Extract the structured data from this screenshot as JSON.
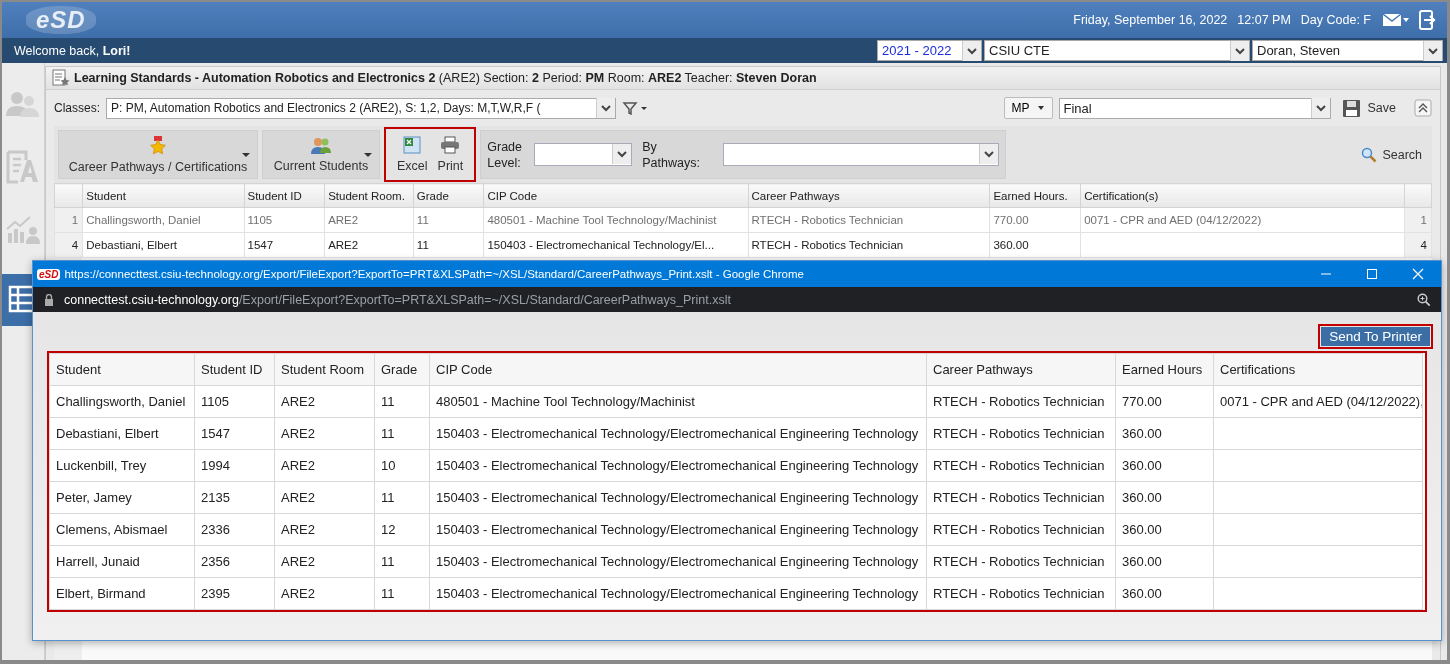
{
  "header": {
    "logo": "eSD",
    "date": "Friday, September 16, 2022",
    "time": "12:07 PM",
    "day_code": "Day Code: F"
  },
  "welcome": "Welcome back, **Lori!**",
  "selectors": [
    {
      "value": "2021 - 2022",
      "accent": true
    },
    {
      "value": "CSIU CTE",
      "accent": false
    },
    {
      "value": "Doran, Steven",
      "accent": false
    }
  ],
  "sidebar": {
    "items": [
      {
        "kind": "people",
        "selected": false
      },
      {
        "kind": "form",
        "selected": false
      },
      {
        "kind": "chart",
        "selected": false
      },
      {
        "kind": "table",
        "selected": true
      }
    ]
  },
  "panel": {
    "title": "**Learning Standards - Automation Robotics and Electronics 2** (ARE2) Section: **2** Period: **PM** Room: **ARE2** Teacher: **Steven Doran**",
    "classes_label": "Classes:",
    "classes_value": "P: PM, Automation Robotics and Electronics  2 (ARE2), S: 1,2, Days: M,T,W,R,F (",
    "mp": "MP",
    "term": "Final",
    "save": "Save"
  },
  "toolbar": {
    "career": "Career Pathways / Certifications",
    "students": "Current Students",
    "excel": "Excel",
    "print": "Print",
    "export_highlighted": true,
    "grade_label": "Grade Level:",
    "pathways_label": "By Pathways:",
    "search": "Search"
  },
  "grid": {
    "columns": [
      "Student",
      "Student ID",
      "Student Room.",
      "Grade",
      "CIP Code",
      "Career Pathways",
      "Earned Hours.",
      "Certification(s)"
    ],
    "rows": [
      {
        "num": "1",
        "dimmed": true,
        "cells": [
          "Challingsworth, Daniel",
          "1105",
          "ARE2",
          "11",
          "480501 - Machine Tool Technology/Machinist",
          "RTECH - Robotics Technician",
          "770.00",
          "0071 - CPR and AED (04/12/2022)"
        ],
        "end": "1"
      },
      {
        "num": "4",
        "dimmed": false,
        "cells": [
          "Debastiani, Elbert",
          "1547",
          "ARE2",
          "11",
          "150403 - Electromechanical Technology/El...",
          "RTECH - Robotics Technician",
          "360.00",
          ""
        ],
        "end": "4"
      }
    ]
  },
  "popup": {
    "favicon": "eSD",
    "title": "https://connecttest.csiu-technology.org/Export/FileExport?ExportTo=PRT&XLSPath=~/XSL/Standard/CareerPathways_Print.xslt - Google Chrome",
    "url_host": "connecttest.csiu-technology.org",
    "url_path": "/Export/FileExport?ExportTo=PRT&XLSPath=~/XSL/Standard/CareerPathways_Print.xslt",
    "send_button": "Send To Printer",
    "send_highlighted": true,
    "table_highlighted": true,
    "columns": [
      "Student",
      "Student ID",
      "Student Room",
      "Grade",
      "CIP Code",
      "Career Pathways",
      "Earned Hours",
      "Certifications"
    ],
    "rows": [
      [
        "Challingsworth, Daniel",
        "1105",
        "ARE2",
        "11",
        "480501 - Machine Tool Technology/Machinist",
        "RTECH - Robotics Technician",
        "770.00",
        "0071 - CPR and AED (04/12/2022),"
      ],
      [
        "Debastiani, Elbert",
        "1547",
        "ARE2",
        "11",
        "150403 - Electromechanical Technology/Electromechanical Engineering Technology",
        "RTECH - Robotics Technician",
        "360.00",
        ""
      ],
      [
        "Luckenbill, Trey",
        "1994",
        "ARE2",
        "10",
        "150403 - Electromechanical Technology/Electromechanical Engineering Technology",
        "RTECH - Robotics Technician",
        "360.00",
        ""
      ],
      [
        "Peter, Jamey",
        "2135",
        "ARE2",
        "11",
        "150403 - Electromechanical Technology/Electromechanical Engineering Technology",
        "RTECH - Robotics Technician",
        "360.00",
        ""
      ],
      [
        "Clemens, Abismael",
        "2336",
        "ARE2",
        "12",
        "150403 - Electromechanical Technology/Electromechanical Engineering Technology",
        "RTECH - Robotics Technician",
        "360.00",
        ""
      ],
      [
        "Harrell, Junaid",
        "2356",
        "ARE2",
        "11",
        "150403 - Electromechanical Technology/Electromechanical Engineering Technology",
        "RTECH - Robotics Technician",
        "360.00",
        ""
      ],
      [
        "Elbert, Birmand",
        "2395",
        "ARE2",
        "11",
        "150403 - Electromechanical Technology/Electromechanical Engineering Technology",
        "RTECH - Robotics Technician",
        "360.00",
        ""
      ]
    ]
  }
}
